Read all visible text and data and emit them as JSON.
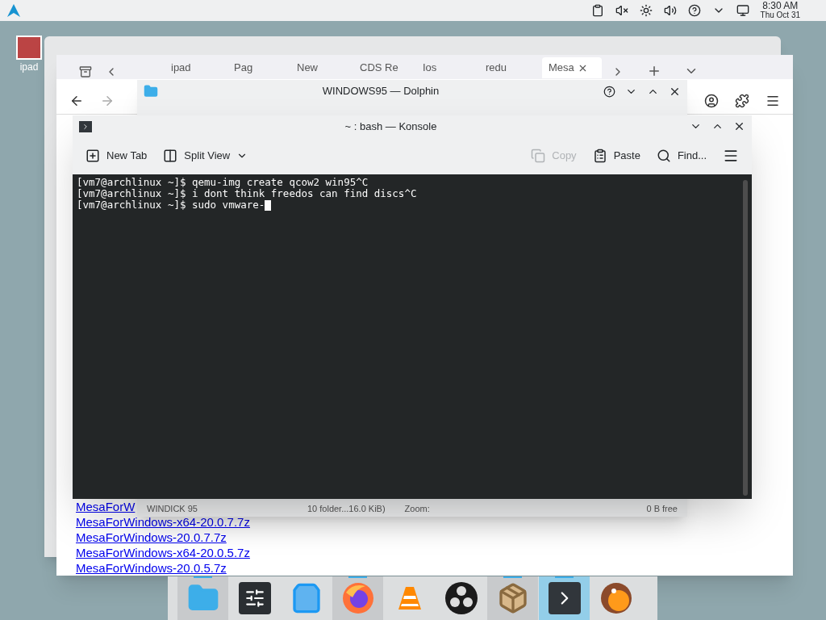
{
  "panel": {
    "time": "8:30 AM",
    "date": "Thu Oct 31"
  },
  "desktop_icon": {
    "label": "ipad"
  },
  "browser": {
    "tabs": [
      {
        "label": "ipad",
        "selected": false
      },
      {
        "label": "Pag",
        "selected": false
      },
      {
        "label": "New",
        "selected": false
      },
      {
        "label": "CDS Re",
        "selected": false
      },
      {
        "label": "Ios",
        "selected": false
      },
      {
        "label": "redu",
        "selected": false
      },
      {
        "label": "Mesa",
        "selected": true
      }
    ],
    "links": [
      "MesaForW",
      "MesaForWindows-x64-20.0.7.7z",
      "MesaForWindows-20.0.7.7z",
      "MesaForWindows-x64-20.0.5.7z",
      "MesaForWindows-20.0.5.7z"
    ]
  },
  "dolphin": {
    "title": "WINDOWS95 — Dolphin",
    "status": {
      "place": "WINDICK 95",
      "summary": "10 folder...16.0 KiB)",
      "zoom": "Zoom:",
      "free": "0 B free"
    }
  },
  "konsole": {
    "title": "~ : bash — Konsole",
    "toolbar": [
      {
        "label": "New Tab",
        "kind": "newtab",
        "disabled": false
      },
      {
        "label": "Split View",
        "kind": "split",
        "disabled": false
      },
      {
        "label": "Copy",
        "kind": "copy",
        "disabled": true
      },
      {
        "label": "Paste",
        "kind": "paste",
        "disabled": false
      },
      {
        "label": "Find...",
        "kind": "find",
        "disabled": false
      }
    ],
    "lines": [
      "[vm7@archlinux ~]$ qemu-img create qcow2 win95^C",
      "[vm7@archlinux ~]$ i dont think freedos can find discs^C",
      "[vm7@archlinux ~]$ sudo vmware-"
    ]
  },
  "dock": [
    {
      "kind": "files",
      "running": true,
      "selected": false
    },
    {
      "kind": "settings",
      "running": false,
      "selected": false
    },
    {
      "kind": "store",
      "running": false,
      "selected": false
    },
    {
      "kind": "firefox",
      "running": true,
      "selected": false
    },
    {
      "kind": "vlc",
      "running": false,
      "selected": false
    },
    {
      "kind": "obs",
      "running": false,
      "selected": false
    },
    {
      "kind": "package",
      "running": true,
      "selected": false
    },
    {
      "kind": "terminal",
      "running": true,
      "selected": true
    },
    {
      "kind": "bird",
      "running": false,
      "selected": false
    }
  ]
}
